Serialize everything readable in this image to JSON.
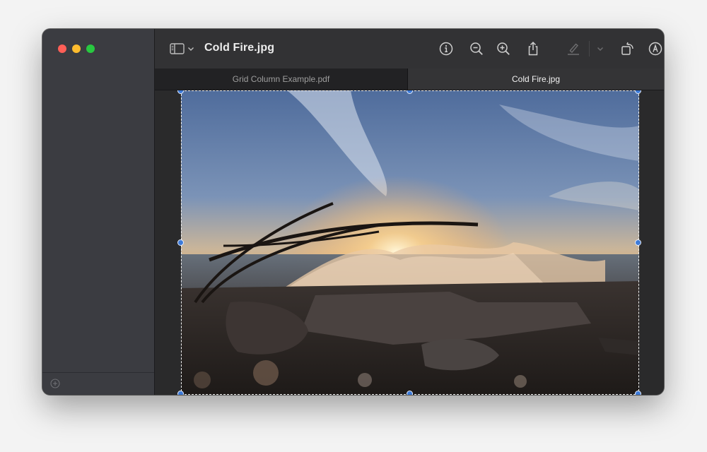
{
  "window": {
    "title": "Cold Fire.jpg"
  },
  "tabs": [
    {
      "label": "Grid Column Example.pdf",
      "active": false
    },
    {
      "label": "Cold Fire.jpg",
      "active": true
    }
  ],
  "toolbar": {
    "icons": [
      "sidebar-icon",
      "chevron-down-icon",
      "info-icon",
      "zoom-out-icon",
      "zoom-in-icon",
      "share-icon",
      "highlight-pen-icon",
      "chevron-down-icon",
      "rotate-icon",
      "markup-icon",
      "search-icon"
    ]
  },
  "sidebar": {
    "footer_icon": "add-icon"
  },
  "colors": {
    "accent": "#3d7bd9",
    "close": "#ff5f57",
    "minimize": "#febc2e",
    "maximize": "#28c840"
  }
}
